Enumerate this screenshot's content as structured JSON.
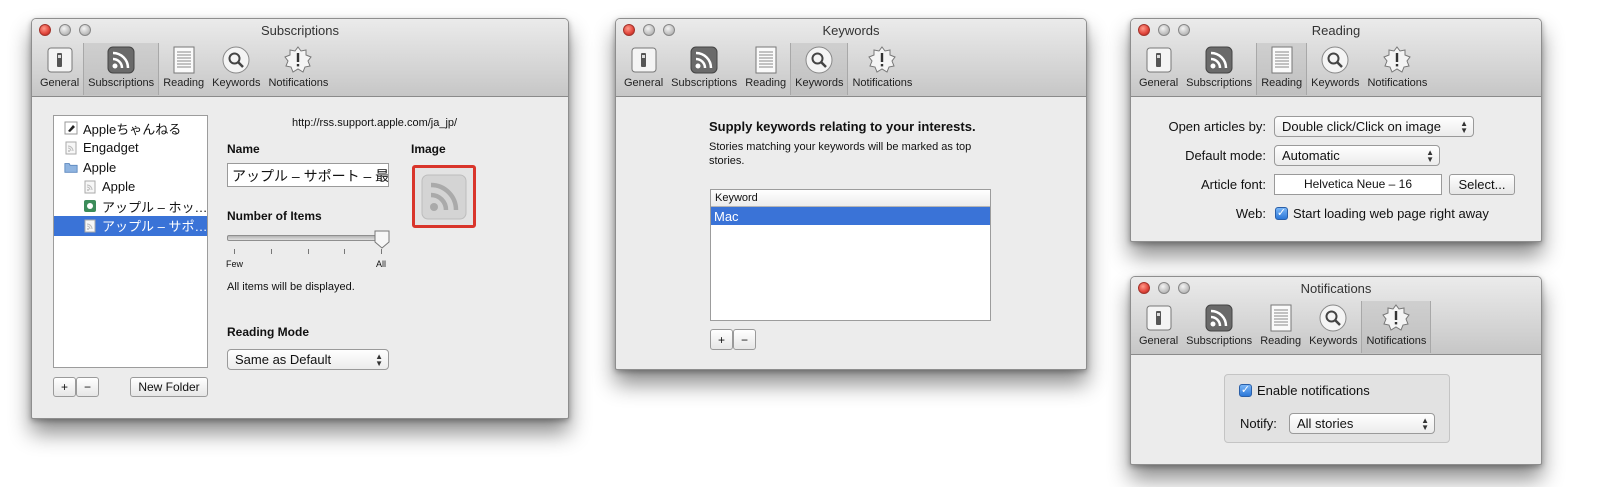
{
  "toolbar_tabs": [
    "General",
    "Subscriptions",
    "Reading",
    "Keywords",
    "Notifications"
  ],
  "subscriptions": {
    "window_title": "Subscriptions",
    "feed_list": [
      {
        "label": "Appleちゃんねる",
        "indent": 0,
        "icon": "apple-channel-icon"
      },
      {
        "label": "Engadget",
        "indent": 0,
        "icon": "feed-file-icon"
      },
      {
        "label": "Apple",
        "indent": 0,
        "icon": "folder-icon"
      },
      {
        "label": "Apple",
        "indent": 1,
        "icon": "feed-file-icon"
      },
      {
        "label": "アップル – ホッ…",
        "indent": 1,
        "icon": "green-feed-icon"
      },
      {
        "label": "アップル – サポ…",
        "indent": 1,
        "icon": "feed-file-icon",
        "selected": true
      }
    ],
    "add_label": "+",
    "remove_label": "−",
    "new_folder_label": "New Folder",
    "url": "http://rss.support.apple.com/ja_jp/",
    "name_label": "Name",
    "name_value": "アップル – サポート – 最",
    "image_label": "Image",
    "items_label": "Number of Items",
    "slider_min_label": "Few",
    "slider_max_label": "All",
    "slider_value": 1.0,
    "items_note": "All items will be displayed.",
    "reading_mode_label": "Reading Mode",
    "reading_mode_value": "Same as Default"
  },
  "keywords": {
    "window_title": "Keywords",
    "heading": "Supply keywords relating to your interests.",
    "description": "Stories matching your keywords will be marked as top stories.",
    "column_header": "Keyword",
    "rows": [
      "Mac"
    ],
    "add_label": "+",
    "remove_label": "−"
  },
  "reading": {
    "window_title": "Reading",
    "open_articles_label": "Open articles by:",
    "open_articles_value": "Double click/Click on image",
    "default_mode_label": "Default mode:",
    "default_mode_value": "Automatic",
    "font_label": "Article font:",
    "font_value": "Helvetica Neue – 16",
    "select_label": "Select...",
    "web_label": "Web:",
    "web_checkbox_label": "Start loading web page right away",
    "web_checked": true
  },
  "notifications": {
    "window_title": "Notifications",
    "enable_label": "Enable notifications",
    "enable_checked": true,
    "notify_label": "Notify:",
    "notify_value": "All stories"
  },
  "colors": {
    "selection": "#3a73d7",
    "close_button": "#e0443a",
    "image_well_border": "#d9352b"
  }
}
